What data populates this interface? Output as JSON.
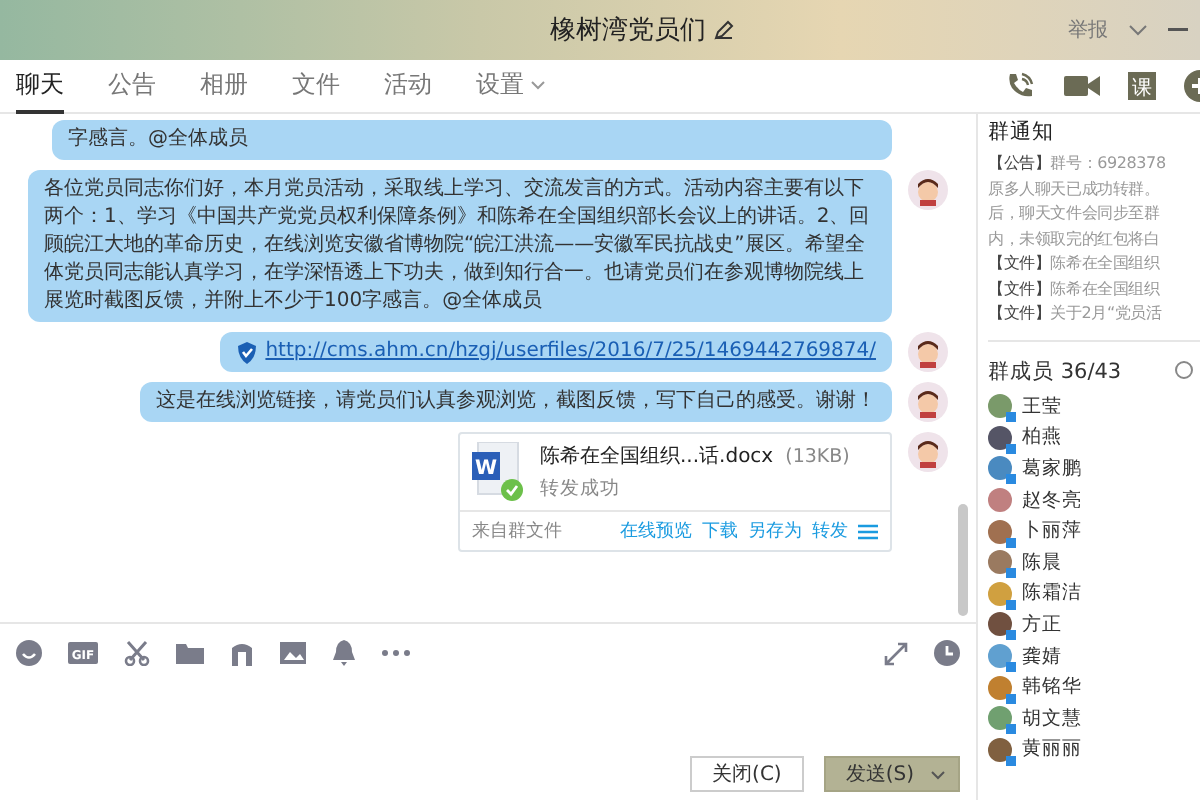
{
  "window": {
    "title": "橡树湾党员们",
    "report": "举报"
  },
  "tabs": [
    {
      "label": "聊天",
      "selected": true,
      "dropdown": false
    },
    {
      "label": "公告",
      "selected": false,
      "dropdown": false
    },
    {
      "label": "相册",
      "selected": false,
      "dropdown": false
    },
    {
      "label": "文件",
      "selected": false,
      "dropdown": false
    },
    {
      "label": "活动",
      "selected": false,
      "dropdown": false
    },
    {
      "label": "设置",
      "selected": false,
      "dropdown": true
    }
  ],
  "messages": [
    {
      "kind": "text",
      "text": "字感言。@全体成员"
    },
    {
      "kind": "text",
      "text": "各位党员同志你们好，本月党员活动，采取线上学习、交流发言的方式。活动内容主要有以下两个：1、学习《中国共产党党员权利保障条例》和陈希在全国组织部长会议上的讲话。2、回顾皖江大地的革命历史，在线浏览安徽省博物院“皖江洪流——安徽军民抗战史”展区。希望全体党员同志能认真学习，在学深悟透上下功夫，做到知行合一。也请党员们在参观博物院线上展览时截图反馈，并附上不少于100字感言。@全体成员"
    },
    {
      "kind": "link",
      "text": "http://cms.ahm.cn/hzgj/userfiles/2016/7/25/1469442769874/"
    },
    {
      "kind": "text",
      "text": "这是在线浏览链接，请党员们认真参观浏览，截图反馈，写下自己的感受。谢谢！"
    },
    {
      "kind": "file",
      "icon_label": "W",
      "name": "陈希在全国组织...话.docx",
      "size": "(13KB)",
      "status": "转发成功",
      "source": "来自群文件",
      "actions": [
        "在线预览",
        "下载",
        "另存为",
        "转发"
      ]
    }
  ],
  "notice": {
    "title": "群通知",
    "lines": [
      {
        "tag": "【公告】",
        "text": "群号：6928378"
      },
      {
        "text": "原多人聊天已成功转群。"
      },
      {
        "text": "后，聊天文件会同步至群"
      },
      {
        "text": "内，未领取完的红包将白"
      },
      {
        "tag": "【文件】",
        "text": "陈希在全国组织"
      },
      {
        "tag": "【文件】",
        "text": "陈希在全国组织"
      },
      {
        "tag": "【文件】",
        "text": "关于2月“党员活"
      }
    ]
  },
  "members": {
    "title": "群成员 36/43",
    "items": [
      {
        "name": "王莹",
        "mobile": true
      },
      {
        "name": "柏燕",
        "mobile": true
      },
      {
        "name": "葛家鹏",
        "mobile": true
      },
      {
        "name": "赵冬亮",
        "mobile": false
      },
      {
        "name": "卜丽萍",
        "mobile": true
      },
      {
        "name": "陈晨",
        "mobile": true
      },
      {
        "name": "陈霜洁",
        "mobile": true
      },
      {
        "name": "方正",
        "mobile": true
      },
      {
        "name": "龚婧",
        "mobile": true
      },
      {
        "name": "韩铭华",
        "mobile": true
      },
      {
        "name": "胡文慧",
        "mobile": true
      },
      {
        "name": "黄丽丽",
        "mobile": true
      }
    ]
  },
  "toolbar": {
    "class_label": "课",
    "gif_label": "GIF"
  },
  "buttons": {
    "close": "关闭(C)",
    "send": "发送(S)"
  }
}
